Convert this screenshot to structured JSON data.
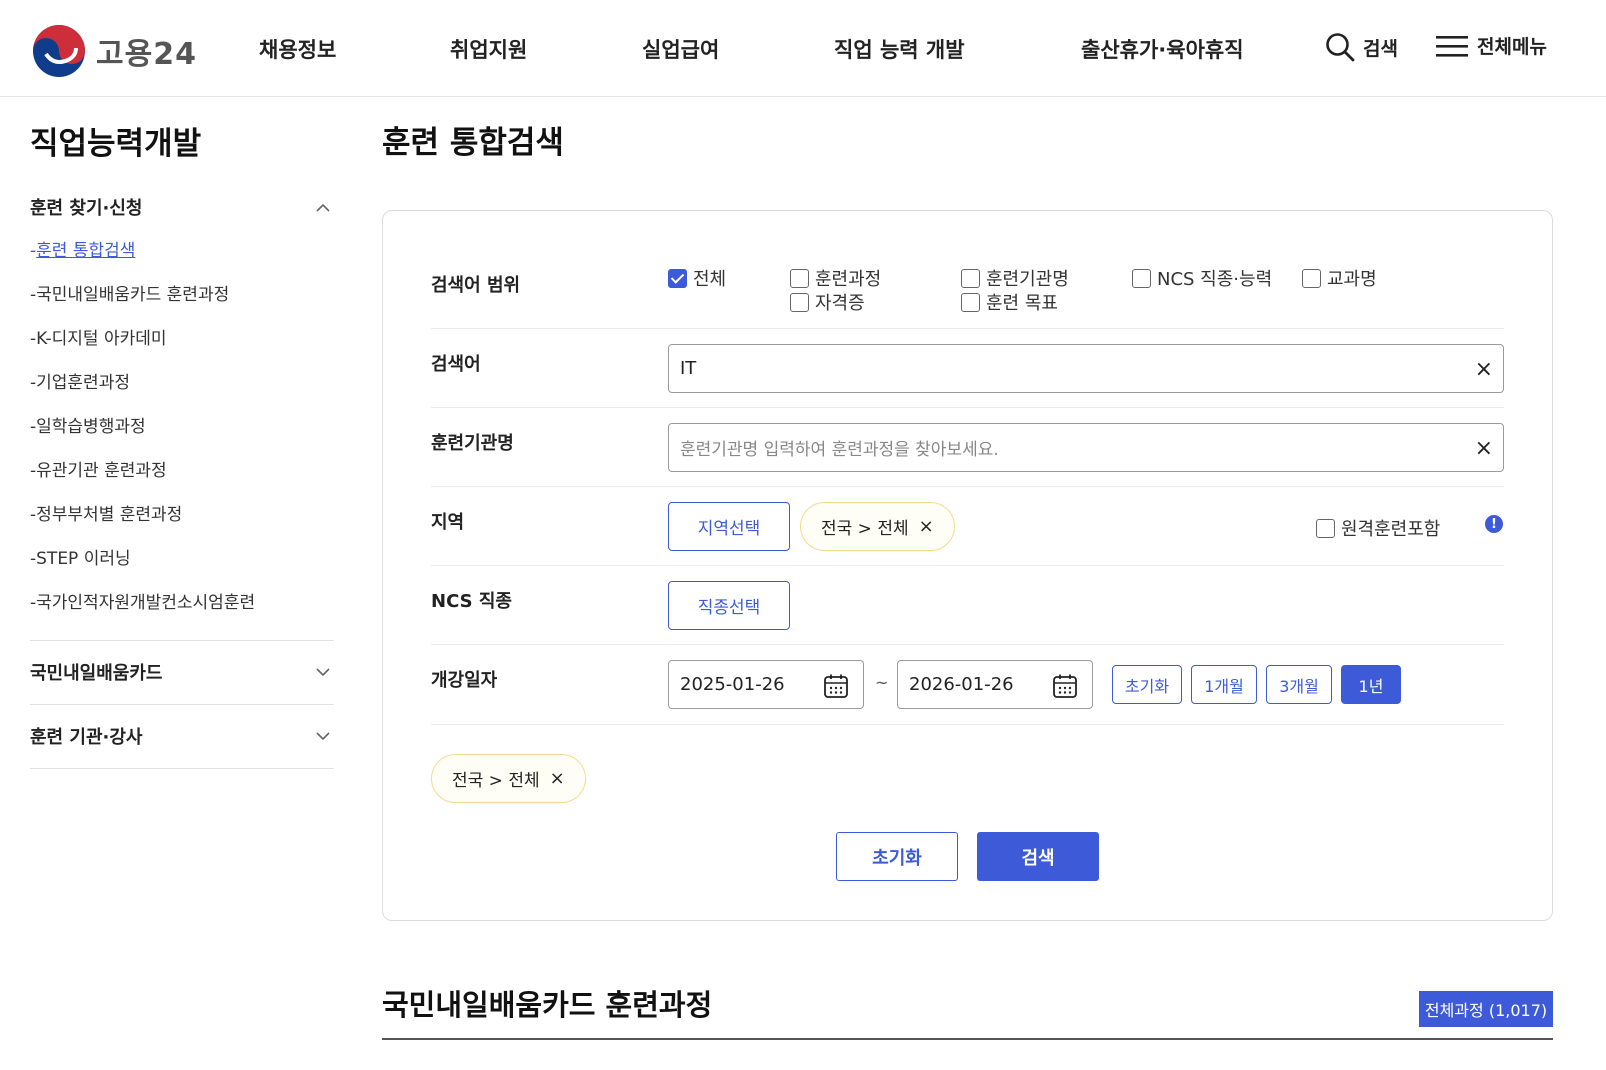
{
  "header": {
    "logo_text": "고용24",
    "nav": [
      "채용정보",
      "취업지원",
      "실업급여",
      "직업 능력 개발",
      "출산휴가·육아휴직"
    ],
    "search_label": "검색",
    "menu_label": "전체메뉴"
  },
  "sidebar": {
    "title": "직업능력개발",
    "groups": [
      {
        "label": "훈련 찾기·신청",
        "expanded": true,
        "items": [
          "훈련 통합검색",
          "국민내일배움카드 훈련과정",
          "K-디지털 아카데미",
          "기업훈련과정",
          "일학습병행과정",
          "유관기관 훈련과정",
          "정부부처별 훈련과정",
          "STEP 이러닝",
          "국가인적자원개발컨소시엄훈련"
        ],
        "active_index": 0
      },
      {
        "label": "국민내일배움카드",
        "expanded": false
      },
      {
        "label": "훈련 기관·강사",
        "expanded": false
      }
    ]
  },
  "main": {
    "page_title": "훈련 통합검색",
    "scope": {
      "label": "검색어 범위",
      "options": [
        {
          "label": "전체",
          "checked": true
        },
        {
          "label": "훈련과정",
          "checked": false
        },
        {
          "label": "자격증",
          "checked": false
        },
        {
          "label": "훈련기관명",
          "checked": false
        },
        {
          "label": "훈련 목표",
          "checked": false
        },
        {
          "label": "NCS 직종·능력",
          "checked": false
        },
        {
          "label": "교과명",
          "checked": false
        }
      ]
    },
    "keyword": {
      "label": "검색어",
      "value": "IT"
    },
    "institution": {
      "label": "훈련기관명",
      "placeholder": "훈련기관명 입력하여 훈련과정을 찾아보세요."
    },
    "region": {
      "label": "지역",
      "select_button": "지역선택",
      "chip": "전국 > 전체",
      "remote_label": "원격훈련포함",
      "remote_checked": false
    },
    "ncs": {
      "label": "NCS 직종",
      "select_button": "직종선택"
    },
    "period": {
      "label": "개강일자",
      "start": "2025-01-26",
      "separator": "~",
      "end": "2026-01-26",
      "buttons": [
        "초기화",
        "1개월",
        "3개월",
        "1년"
      ],
      "active_index": 3
    },
    "selected_chip": "전국 > 전체",
    "reset_button": "초기화",
    "search_button": "검색",
    "section2_title": "국민내일배움카드 훈련과정",
    "total_badge": "전체과정 (1,017)"
  },
  "colors": {
    "accent": "#3d5bd9",
    "chip_border": "#f2dc8f",
    "chip_bg": "#fffef6",
    "logo_red": "#cd2e3a",
    "logo_blue": "#0f3d8c"
  }
}
